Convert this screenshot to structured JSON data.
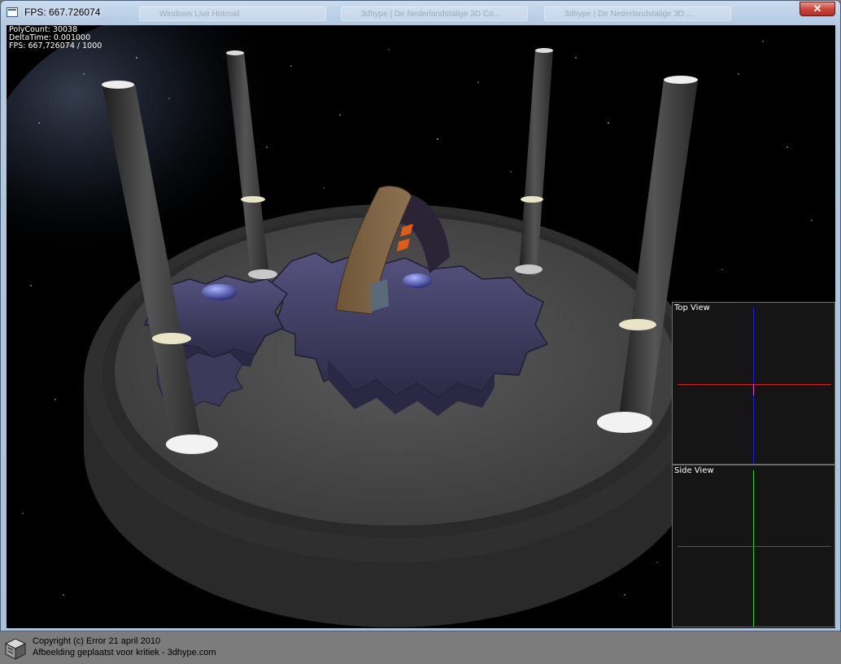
{
  "window": {
    "title": "FPS: 667.726074",
    "close_glyph": "✕",
    "background_tabs": [
      "Windows Live Hotmail",
      "3dhype | De Nederlandstalige 3D Co...",
      "3dhype | De Nederlandstalige 3D ..."
    ]
  },
  "hud": {
    "polycount": "PolyCount: 30038",
    "deltatime": "DeltaTime: 0.001000",
    "fps": "FPS: 667,726074 / 1000"
  },
  "top_view": {
    "label": "Top View"
  },
  "side_view": {
    "label": "Side View"
  },
  "footer": {
    "copyright": "Copyright (c) Error 21 april 2010",
    "caption": "Afbeelding geplaatst voor kritiek - 3dhype.com"
  },
  "colors": {
    "axis_red": "#e01818",
    "axis_blue": "#2020e0",
    "axis_green": "#20d020",
    "axis_magenta": "#e040e0",
    "gear": "#4a4770",
    "platform": "#3c3c3c",
    "pillar": "#3a3a3a"
  },
  "icons": {
    "app": "window-icon",
    "close": "close-icon",
    "footer": "box-icon"
  }
}
